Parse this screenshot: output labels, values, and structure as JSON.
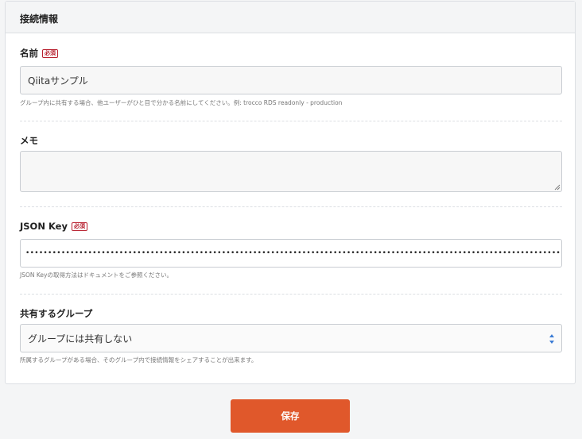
{
  "card": {
    "title": "接続情報"
  },
  "fields": {
    "name": {
      "label": "名前",
      "required_badge": "必須",
      "value": "Qiitaサンプル",
      "hint": "グループ内に共有する場合、他ユーザーがひと目で分かる名前にしてください。例: trocco RDS readonly - production"
    },
    "memo": {
      "label": "メモ",
      "value": ""
    },
    "json_key": {
      "label": "JSON Key",
      "required_badge": "必須",
      "masked_value": "••••••••••••••••••••••••••••••••••••••••••••••••••••••••••••••••••••••••••••••••••••••••••••••••••••••••••••••••••••••••••••••••••••••••••••",
      "hint": "JSON Keyの取得方法はドキュメントをご参照ください。"
    },
    "group": {
      "label": "共有するグループ",
      "selected": "グループには共有しない",
      "hint": "所属するグループがある場合、そのグループ内で接続情報をシェアすることが出来ます。"
    }
  },
  "actions": {
    "save_label": "保存"
  },
  "colors": {
    "primary": "#e0582b",
    "required": "#b8202f",
    "select_arrows": "#3a7bd5"
  }
}
